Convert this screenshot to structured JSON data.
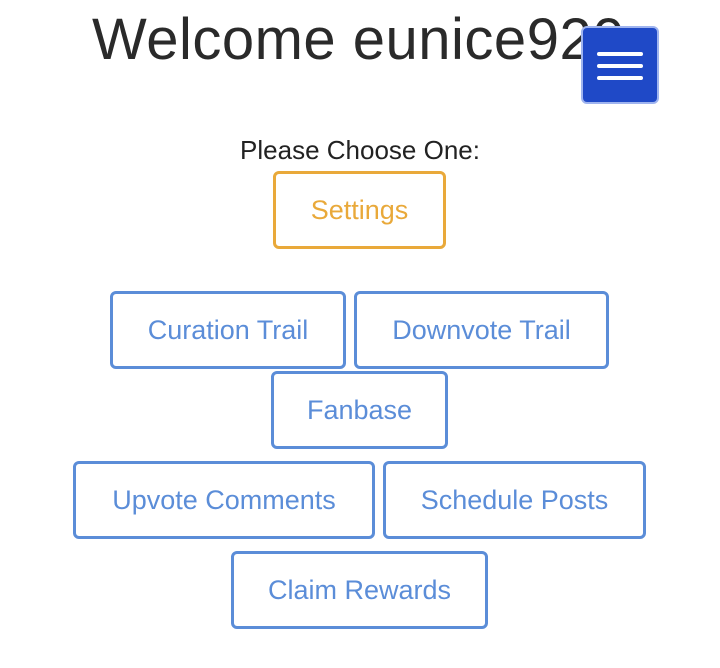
{
  "header": {
    "title": "Welcome eunice920",
    "menu_icon": "hamburger-menu-icon",
    "menu_color": "#1f49c7"
  },
  "prompt": "Please Choose One:",
  "buttons": {
    "settings": "Settings",
    "curation_trail": "Curation Trail",
    "downvote_trail": "Downvote Trail",
    "fanbase": "Fanbase",
    "upvote_comments": "Upvote Comments",
    "schedule_posts": "Schedule Posts",
    "claim_rewards": "Claim Rewards"
  },
  "colors": {
    "primary_outline": "#5b8dd8",
    "warning_outline": "#e9a93a"
  }
}
